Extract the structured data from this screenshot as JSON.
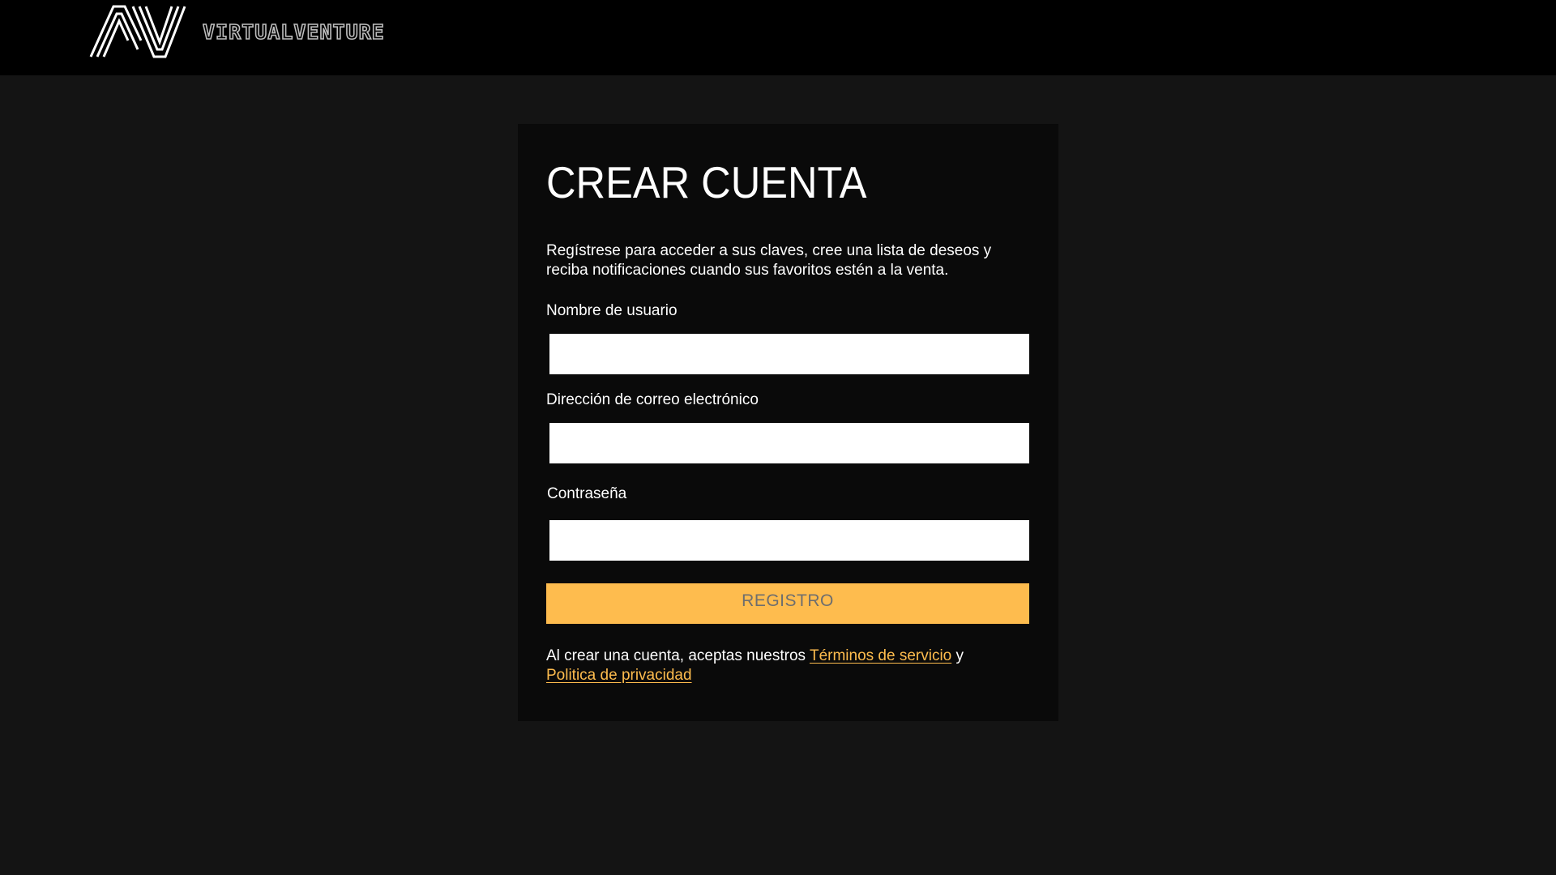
{
  "brand": {
    "name": "VIRTUALVENTURE",
    "mark": "AV"
  },
  "signup": {
    "title": "CREAR CUENTA",
    "intro": "Regístrese para acceder a sus claves, cree una lista de deseos y reciba notificaciones cuando sus favoritos estén a la venta.",
    "username_label": "Nombre de usuario",
    "username_value": "",
    "email_label": "Dirección de correo electrónico",
    "email_value": "",
    "password_label": "Contraseña",
    "password_value": "",
    "submit_label": "REGISTRO",
    "terms_prefix": "Al crear una cuenta, aceptas nuestros ",
    "terms_link": "Términos de servicio",
    "terms_join": " y ",
    "privacy_link": "Politica de privacidad"
  },
  "colors": {
    "page_background": "#141414",
    "header_background": "#000000",
    "card_background": "#0a0a0a",
    "accent": "#febc4e",
    "button_text": "#6e6e6e"
  },
  "icons": {
    "logo": "av-logo-icon"
  }
}
